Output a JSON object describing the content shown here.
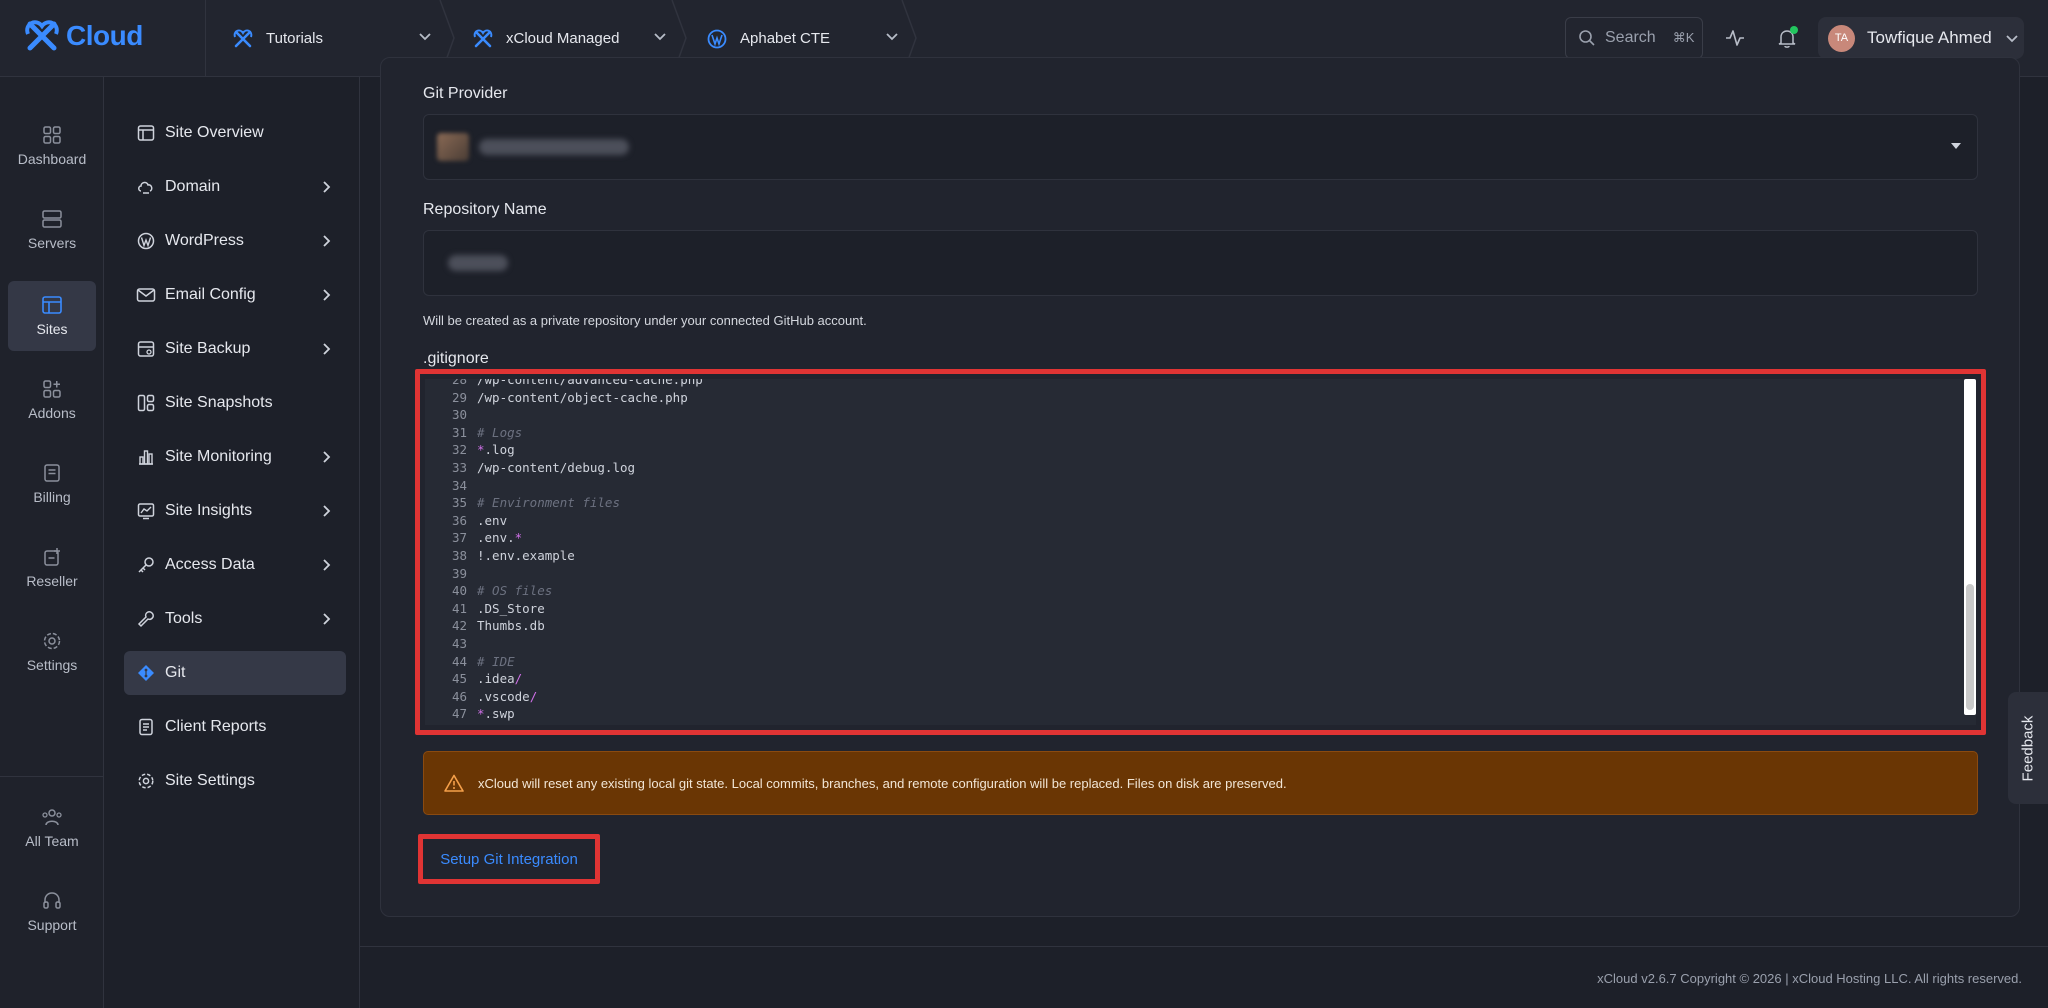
{
  "brand": {
    "name": "Cloud",
    "accent": "#3a8bff"
  },
  "breadcrumbs": [
    {
      "label": "Tutorials",
      "icon": "xcloud-logo-icon"
    },
    {
      "label": "xCloud Managed",
      "icon": "xcloud-logo-icon"
    },
    {
      "label": "Aphabet CTE",
      "icon": "wordpress-icon"
    }
  ],
  "topbar": {
    "search_label": "Search",
    "search_shortcut": "⌘K",
    "user_initials": "TA",
    "user_name": "Towfique Ahmed"
  },
  "rail": [
    {
      "label": "Dashboard",
      "icon": "dashboard-icon"
    },
    {
      "label": "Servers",
      "icon": "servers-icon"
    },
    {
      "label": "Sites",
      "icon": "sites-icon",
      "active": true
    },
    {
      "label": "Addons",
      "icon": "addons-icon"
    },
    {
      "label": "Billing",
      "icon": "billing-icon"
    },
    {
      "label": "Reseller",
      "icon": "reseller-icon"
    },
    {
      "label": "Settings",
      "icon": "settings-icon"
    },
    {
      "label": "All Team",
      "icon": "team-icon"
    },
    {
      "label": "Support",
      "icon": "support-icon"
    }
  ],
  "sidebar": [
    {
      "label": "Site Overview",
      "icon": "overview-icon",
      "chevron": false
    },
    {
      "label": "Domain",
      "icon": "domain-icon",
      "chevron": true
    },
    {
      "label": "WordPress",
      "icon": "wordpress-icon",
      "chevron": true
    },
    {
      "label": "Email Config",
      "icon": "mail-icon",
      "chevron": true
    },
    {
      "label": "Site Backup",
      "icon": "backup-icon",
      "chevron": true
    },
    {
      "label": "Site Snapshots",
      "icon": "snapshots-icon",
      "chevron": false
    },
    {
      "label": "Site Monitoring",
      "icon": "monitoring-icon",
      "chevron": true
    },
    {
      "label": "Site Insights",
      "icon": "insights-icon",
      "chevron": true
    },
    {
      "label": "Access Data",
      "icon": "key-icon",
      "chevron": true
    },
    {
      "label": "Tools",
      "icon": "wrench-icon",
      "chevron": true
    },
    {
      "label": "Git",
      "icon": "git-icon",
      "chevron": false,
      "active": true
    },
    {
      "label": "Client Reports",
      "icon": "reports-icon",
      "chevron": false
    },
    {
      "label": "Site Settings",
      "icon": "gear-icon",
      "chevron": false
    }
  ],
  "form": {
    "git_provider_label": "Git Provider",
    "repository_label": "Repository Name",
    "repository_help": "Will be created as a private repository under your connected GitHub account.",
    "gitignore_label": ".gitignore"
  },
  "editor_lines": [
    {
      "n": "28",
      "parts": [
        {
          "t": "/wp-content/advanced-cache.php",
          "c": "code"
        }
      ]
    },
    {
      "n": "29",
      "parts": [
        {
          "t": "/wp-content/object-cache.php",
          "c": "code"
        }
      ]
    },
    {
      "n": "30",
      "parts": []
    },
    {
      "n": "31",
      "parts": [
        {
          "t": "# Logs",
          "c": "comment"
        }
      ]
    },
    {
      "n": "32",
      "parts": [
        {
          "t": "*",
          "c": "mag"
        },
        {
          "t": ".log",
          "c": "code"
        }
      ]
    },
    {
      "n": "33",
      "parts": [
        {
          "t": "/wp-content/debug.log",
          "c": "code"
        }
      ]
    },
    {
      "n": "34",
      "parts": []
    },
    {
      "n": "35",
      "parts": [
        {
          "t": "# Environment files",
          "c": "comment"
        }
      ]
    },
    {
      "n": "36",
      "parts": [
        {
          "t": ".env",
          "c": "code"
        }
      ]
    },
    {
      "n": "37",
      "parts": [
        {
          "t": ".env.",
          "c": "code"
        },
        {
          "t": "*",
          "c": "mag"
        }
      ]
    },
    {
      "n": "38",
      "parts": [
        {
          "t": "!.env.example",
          "c": "code"
        }
      ]
    },
    {
      "n": "39",
      "parts": []
    },
    {
      "n": "40",
      "parts": [
        {
          "t": "# OS files",
          "c": "comment"
        }
      ]
    },
    {
      "n": "41",
      "parts": [
        {
          "t": ".DS_Store",
          "c": "code"
        }
      ]
    },
    {
      "n": "42",
      "parts": [
        {
          "t": "Thumbs.db",
          "c": "code"
        }
      ]
    },
    {
      "n": "43",
      "parts": []
    },
    {
      "n": "44",
      "parts": [
        {
          "t": "# IDE",
          "c": "comment"
        }
      ]
    },
    {
      "n": "45",
      "parts": [
        {
          "t": ".idea",
          "c": "code"
        },
        {
          "t": "/",
          "c": "mag"
        }
      ]
    },
    {
      "n": "46",
      "parts": [
        {
          "t": ".vscode",
          "c": "code"
        },
        {
          "t": "/",
          "c": "mag"
        }
      ]
    },
    {
      "n": "47",
      "parts": [
        {
          "t": "*",
          "c": "mag"
        },
        {
          "t": ".swp",
          "c": "code"
        }
      ]
    }
  ],
  "warning": {
    "text": "xCloud will reset any existing local git state. Local commits, branches, and remote configuration will be replaced. Files on disk are preserved.",
    "color": "#6a3604"
  },
  "setup_button": "Setup Git Integration",
  "footer": "xCloud v2.6.7 Copyright © 2026 | xCloud Hosting LLC. All rights reserved.",
  "feedback": "Feedback",
  "highlight_color": "#e03434"
}
